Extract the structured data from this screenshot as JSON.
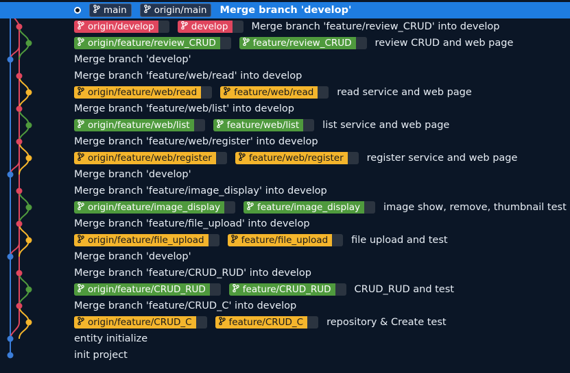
{
  "commits": [
    {
      "refs": [
        {
          "label": "main",
          "color": "blue"
        },
        {
          "label": "origin/main",
          "color": "blue"
        }
      ],
      "message": "Merge branch 'develop'",
      "head": true,
      "selected": true
    },
    {
      "refs": [
        {
          "label": "origin/develop",
          "color": "red"
        },
        {
          "label": "develop",
          "color": "red"
        }
      ],
      "message": "Merge branch 'feature/review_CRUD' into develop"
    },
    {
      "refs": [
        {
          "label": "origin/feature/review_CRUD",
          "color": "green"
        },
        {
          "label": "feature/review_CRUD",
          "color": "green"
        }
      ],
      "message": "review CRUD and web page"
    },
    {
      "refs": [],
      "message": "Merge branch 'develop'"
    },
    {
      "refs": [],
      "message": "Merge branch 'feature/web/read' into develop"
    },
    {
      "refs": [
        {
          "label": "origin/feature/web/read",
          "color": "yellow"
        },
        {
          "label": "feature/web/read",
          "color": "yellow"
        }
      ],
      "message": "read service and web page"
    },
    {
      "refs": [],
      "message": "Merge branch 'feature/web/list' into develop"
    },
    {
      "refs": [
        {
          "label": "origin/feature/web/list",
          "color": "green"
        },
        {
          "label": "feature/web/list",
          "color": "green"
        }
      ],
      "message": "list service and web page"
    },
    {
      "refs": [],
      "message": "Merge branch 'feature/web/register' into develop"
    },
    {
      "refs": [
        {
          "label": "origin/feature/web/register",
          "color": "yellow"
        },
        {
          "label": "feature/web/register",
          "color": "yellow"
        }
      ],
      "message": "register service and web page"
    },
    {
      "refs": [],
      "message": "Merge branch 'develop'"
    },
    {
      "refs": [],
      "message": "Merge branch 'feature/image_display' into develop"
    },
    {
      "refs": [
        {
          "label": "origin/feature/image_display",
          "color": "green"
        },
        {
          "label": "feature/image_display",
          "color": "green"
        }
      ],
      "message": "image show, remove, thumbnail test"
    },
    {
      "refs": [],
      "message": "Merge branch 'feature/file_upload' into develop"
    },
    {
      "refs": [
        {
          "label": "origin/feature/file_upload",
          "color": "yellow"
        },
        {
          "label": "feature/file_upload",
          "color": "yellow"
        }
      ],
      "message": "file upload and test"
    },
    {
      "refs": [],
      "message": "Merge branch 'develop'"
    },
    {
      "refs": [],
      "message": "Merge branch 'feature/CRUD_RUD' into develop"
    },
    {
      "refs": [
        {
          "label": "origin/feature/CRUD_RUD",
          "color": "green"
        },
        {
          "label": "feature/CRUD_RUD",
          "color": "green"
        }
      ],
      "message": "CRUD_RUD and test"
    },
    {
      "refs": [],
      "message": "Merge branch 'feature/CRUD_C' into develop"
    },
    {
      "refs": [
        {
          "label": "origin/feature/CRUD_C",
          "color": "yellow"
        },
        {
          "label": "feature/CRUD_C",
          "color": "yellow"
        }
      ],
      "message": "repository & Create test"
    },
    {
      "refs": [],
      "message": "entity initialize"
    },
    {
      "refs": [],
      "message": "init project"
    }
  ],
  "graph": {
    "lane_colors": {
      "main": "#3b7dd8",
      "develop": "#e0465e",
      "green": "#4f9a3d",
      "yellow": "#f4b52c"
    },
    "row_lanes": [
      "main",
      "develop",
      "green",
      "main",
      "develop",
      "yellow",
      "develop",
      "green",
      "develop",
      "yellow",
      "main",
      "develop",
      "green",
      "develop",
      "yellow",
      "main",
      "develop",
      "green",
      "develop",
      "yellow",
      "main",
      "main"
    ]
  },
  "icons": {
    "branch": "branch-icon",
    "head": "head-marker-icon"
  }
}
